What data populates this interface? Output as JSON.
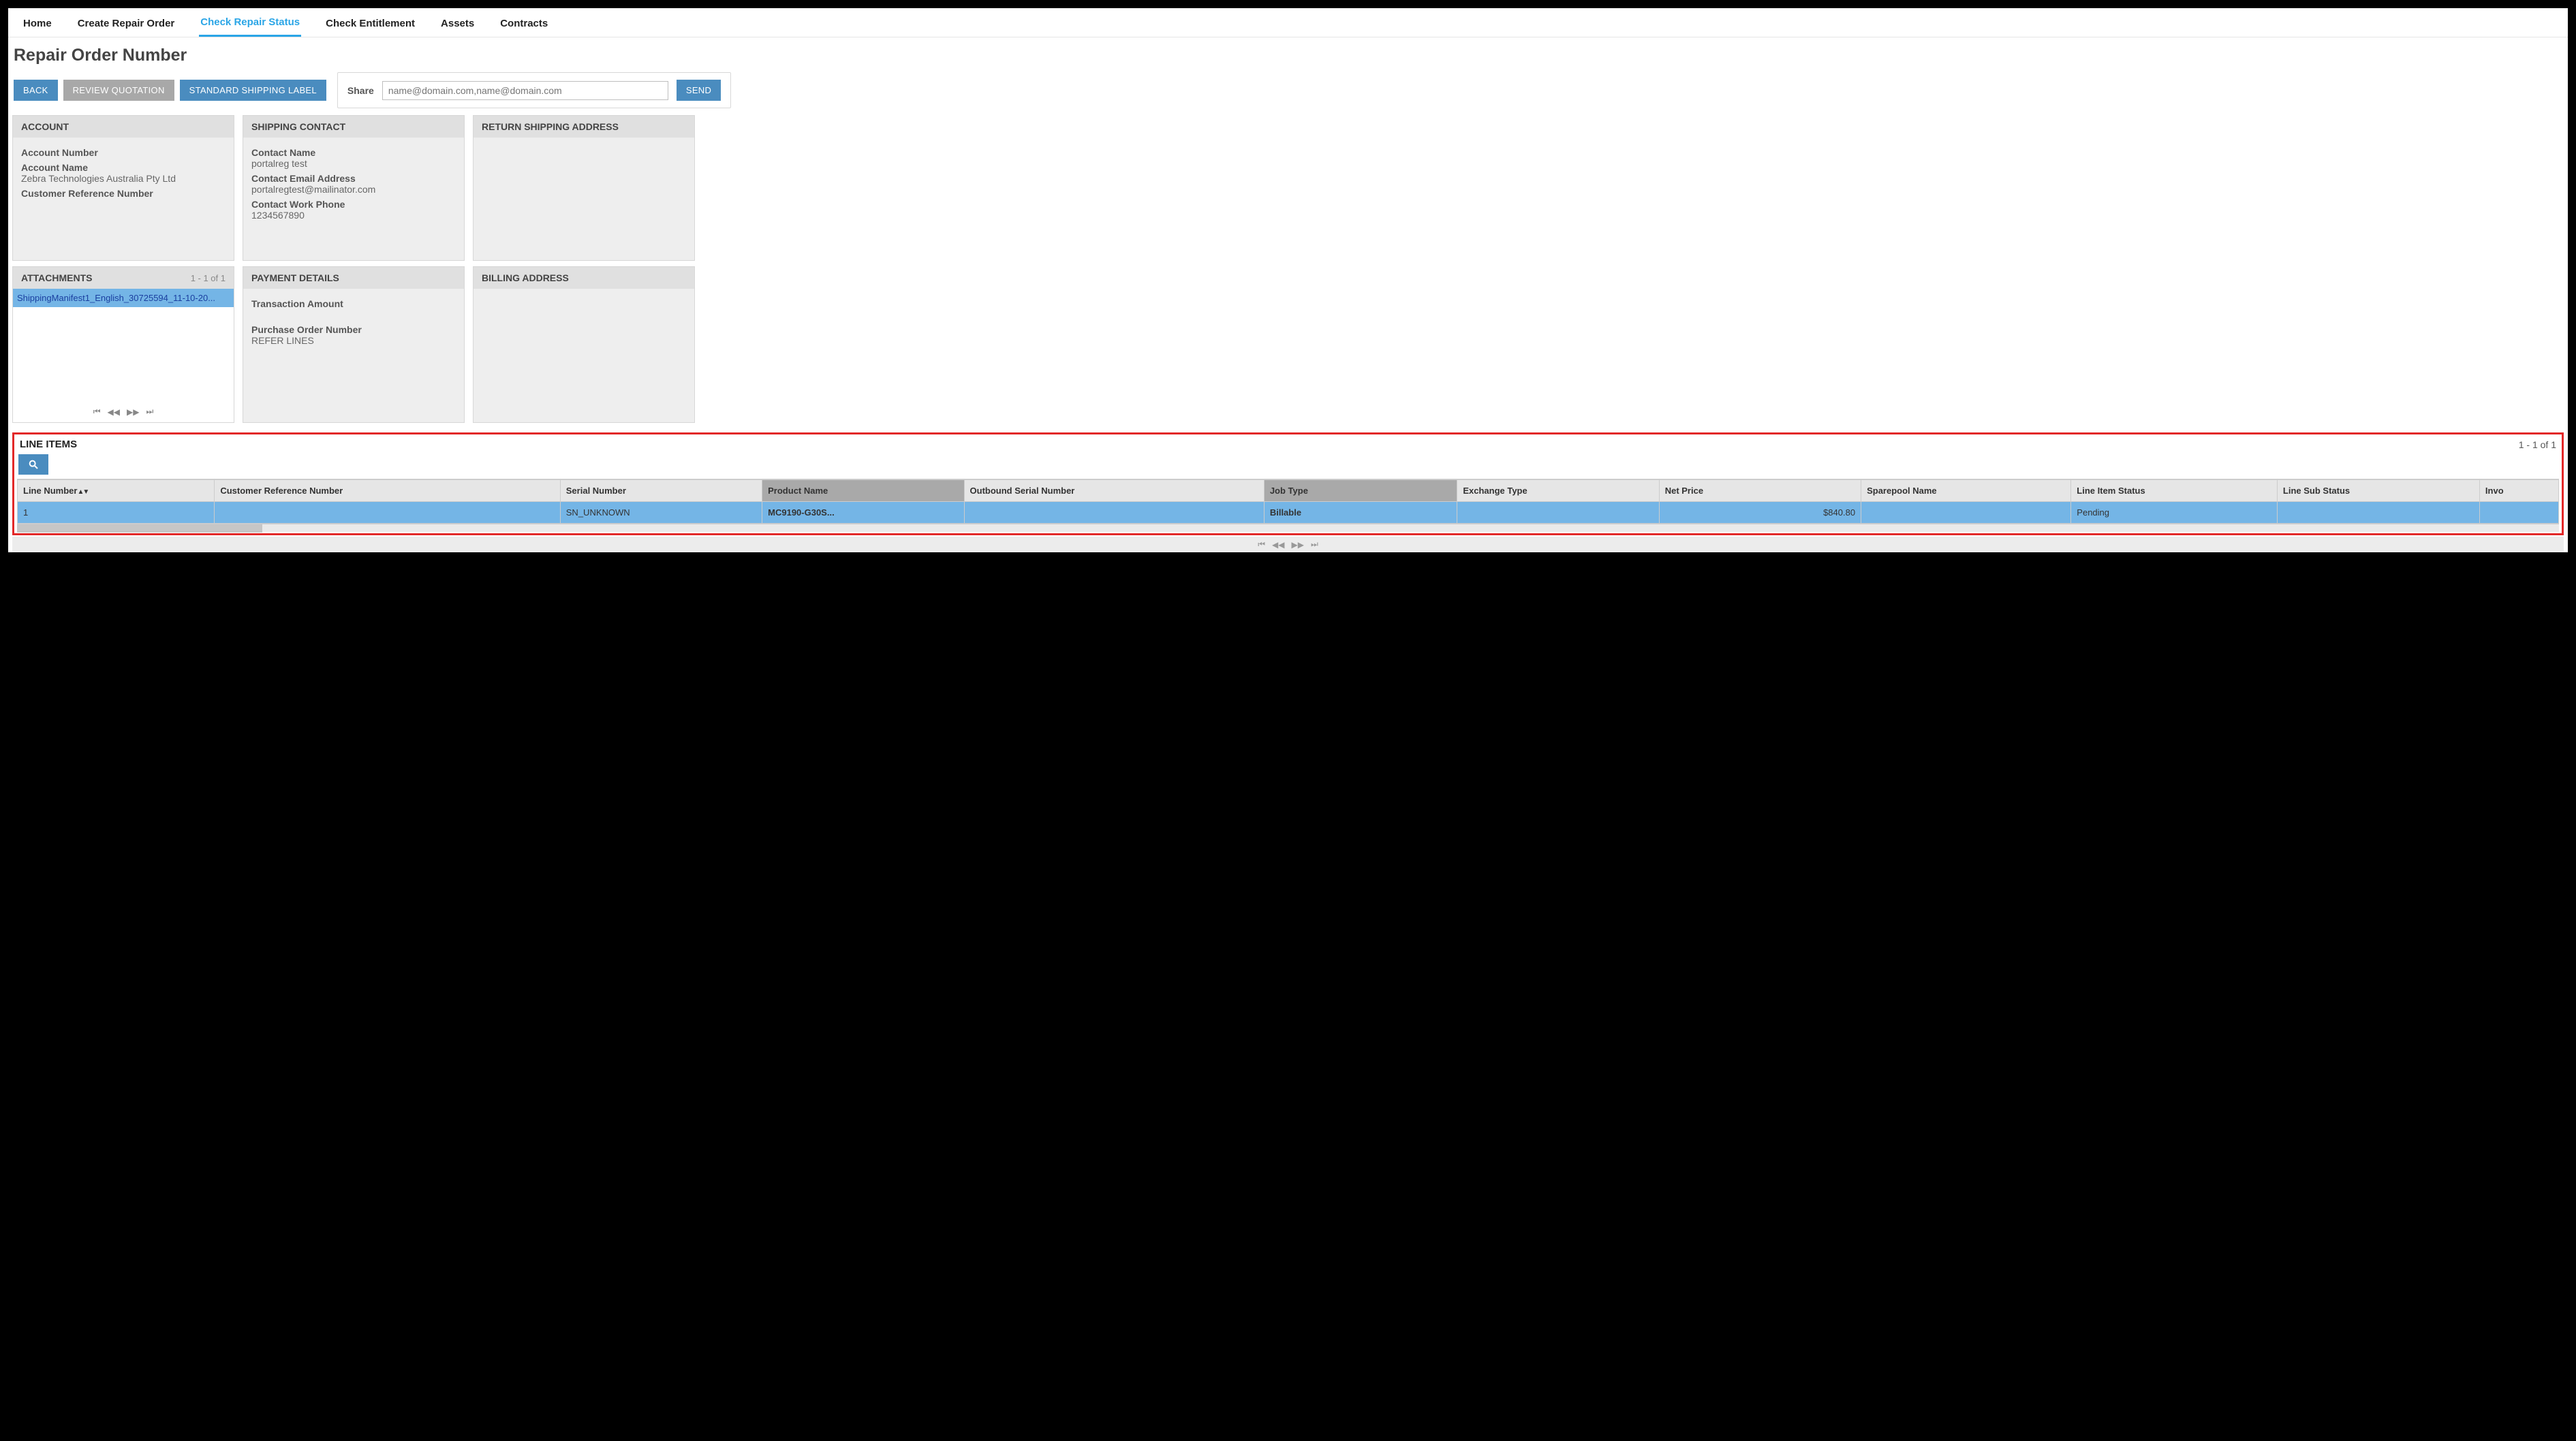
{
  "nav": {
    "tabs": [
      "Home",
      "Create Repair Order",
      "Check Repair Status",
      "Check Entitlement",
      "Assets",
      "Contracts"
    ],
    "active_index": 2
  },
  "page_title": "Repair Order Number",
  "actions": {
    "back": "BACK",
    "review_quotation": "REVIEW QUOTATION",
    "standard_shipping_label": "STANDARD SHIPPING LABEL"
  },
  "share": {
    "label": "Share",
    "placeholder": "name@domain.com,name@domain.com",
    "send": "SEND"
  },
  "account": {
    "title": "ACCOUNT",
    "number_label": "Account Number",
    "number_value": "",
    "name_label": "Account Name",
    "name_value": "Zebra Technologies Australia Pty Ltd",
    "cust_ref_label": "Customer Reference Number",
    "cust_ref_value": ""
  },
  "shipping_contact": {
    "title": "SHIPPING CONTACT",
    "name_label": "Contact Name",
    "name_value": "portalreg test",
    "email_label": "Contact Email Address",
    "email_value": "portalregtest@mailinator.com",
    "phone_label": "Contact Work Phone",
    "phone_value": "1234567890"
  },
  "return_shipping": {
    "title": "RETURN SHIPPING ADDRESS"
  },
  "attachments": {
    "title": "ATTACHMENTS",
    "count": "1 - 1 of 1",
    "items": [
      "ShippingManifest1_English_30725594_11-10-20..."
    ]
  },
  "payment": {
    "title": "PAYMENT DETAILS",
    "txn_label": "Transaction Amount",
    "txn_value": "",
    "po_label": "Purchase Order Number",
    "po_value": "REFER LINES"
  },
  "billing": {
    "title": "BILLING ADDRESS"
  },
  "line_items": {
    "title": "LINE ITEMS",
    "count": "1 - 1 of 1",
    "columns": [
      "Line Number",
      "Customer Reference Number",
      "Serial Number",
      "Product Name",
      "Outbound Serial Number",
      "Job Type",
      "Exchange Type",
      "Net Price",
      "Sparepool Name",
      "Line Item Status",
      "Line Sub Status",
      "Invo"
    ],
    "sorted_col_index": 0,
    "rows": [
      {
        "line_number": "1",
        "customer_reference_number": "",
        "serial_number": "SN_UNKNOWN",
        "product_name": "MC9190-G30S...",
        "outbound_serial_number": "",
        "job_type": "Billable",
        "exchange_type": "",
        "net_price": "$840.80",
        "sparepool_name": "",
        "line_item_status": "Pending",
        "line_sub_status": "",
        "invo": ""
      }
    ]
  }
}
